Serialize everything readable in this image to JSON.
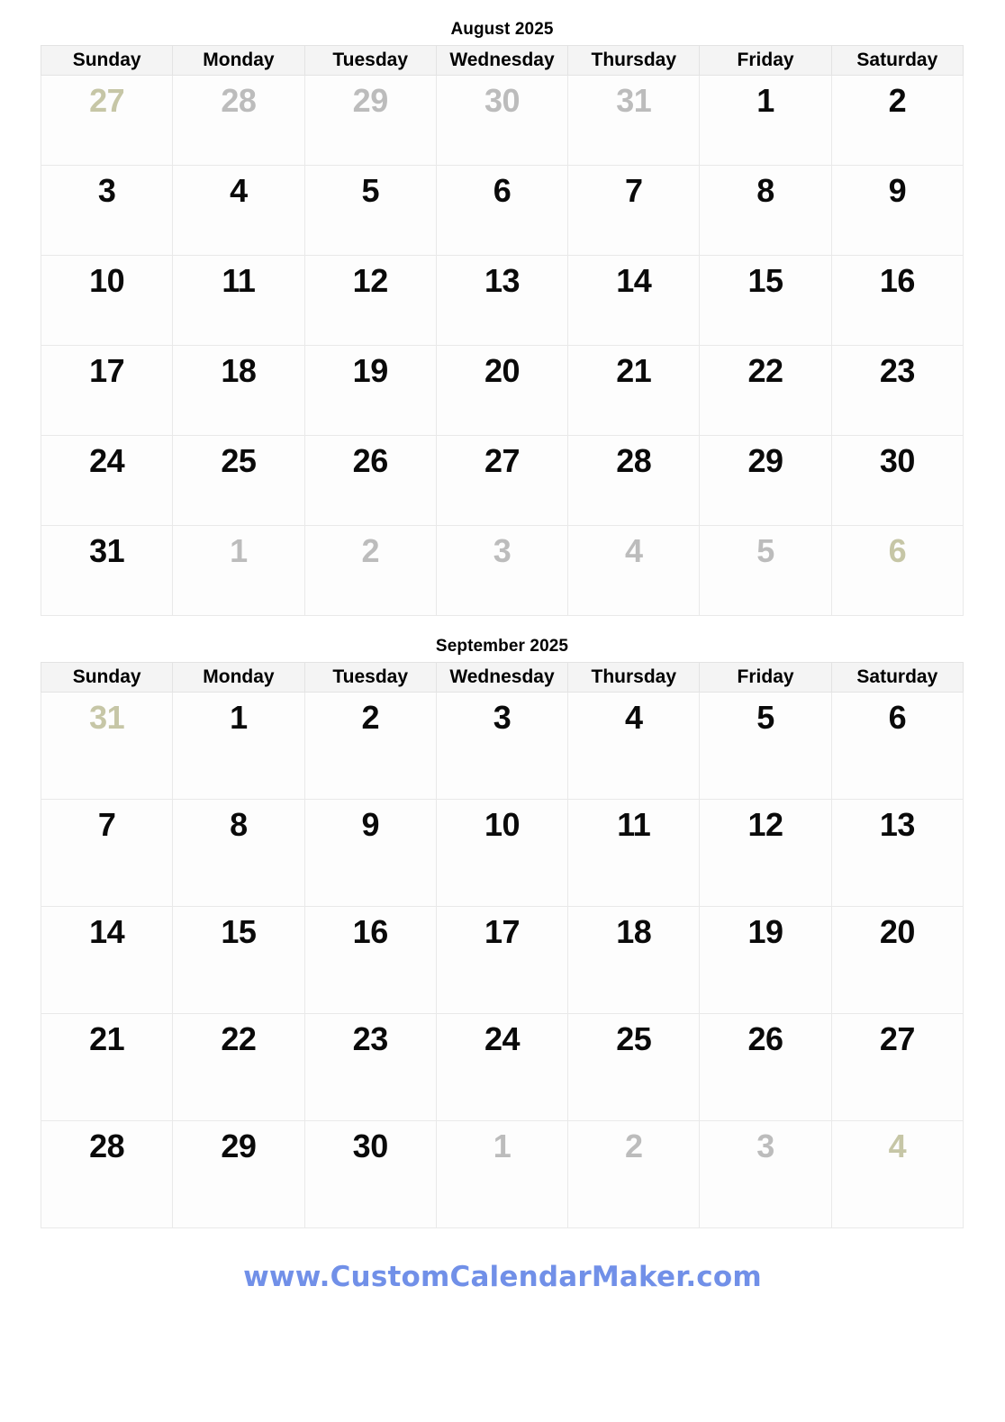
{
  "page": {
    "background_color": "#ffffff",
    "weekend_cell_color": "#fbfbdb",
    "header_row_color": "#f4f4f4",
    "grid_line_color": "#e3e3e3",
    "other_month_text_color": "#bcbcbc",
    "footer_link_color": "#7190e8"
  },
  "weekdays": [
    "Sunday",
    "Monday",
    "Tuesday",
    "Wednesday",
    "Thursday",
    "Friday",
    "Saturday"
  ],
  "calendars": [
    {
      "id": "august",
      "title": "August 2025",
      "weeks": [
        [
          {
            "day": "27",
            "in_month": false
          },
          {
            "day": "28",
            "in_month": false
          },
          {
            "day": "29",
            "in_month": false
          },
          {
            "day": "30",
            "in_month": false
          },
          {
            "day": "31",
            "in_month": false
          },
          {
            "day": "1",
            "in_month": true
          },
          {
            "day": "2",
            "in_month": true
          }
        ],
        [
          {
            "day": "3",
            "in_month": true
          },
          {
            "day": "4",
            "in_month": true
          },
          {
            "day": "5",
            "in_month": true
          },
          {
            "day": "6",
            "in_month": true
          },
          {
            "day": "7",
            "in_month": true
          },
          {
            "day": "8",
            "in_month": true
          },
          {
            "day": "9",
            "in_month": true
          }
        ],
        [
          {
            "day": "10",
            "in_month": true
          },
          {
            "day": "11",
            "in_month": true
          },
          {
            "day": "12",
            "in_month": true
          },
          {
            "day": "13",
            "in_month": true
          },
          {
            "day": "14",
            "in_month": true
          },
          {
            "day": "15",
            "in_month": true
          },
          {
            "day": "16",
            "in_month": true
          }
        ],
        [
          {
            "day": "17",
            "in_month": true
          },
          {
            "day": "18",
            "in_month": true
          },
          {
            "day": "19",
            "in_month": true
          },
          {
            "day": "20",
            "in_month": true
          },
          {
            "day": "21",
            "in_month": true
          },
          {
            "day": "22",
            "in_month": true
          },
          {
            "day": "23",
            "in_month": true
          }
        ],
        [
          {
            "day": "24",
            "in_month": true
          },
          {
            "day": "25",
            "in_month": true
          },
          {
            "day": "26",
            "in_month": true
          },
          {
            "day": "27",
            "in_month": true
          },
          {
            "day": "28",
            "in_month": true
          },
          {
            "day": "29",
            "in_month": true
          },
          {
            "day": "30",
            "in_month": true
          }
        ],
        [
          {
            "day": "31",
            "in_month": true
          },
          {
            "day": "1",
            "in_month": false
          },
          {
            "day": "2",
            "in_month": false
          },
          {
            "day": "3",
            "in_month": false
          },
          {
            "day": "4",
            "in_month": false
          },
          {
            "day": "5",
            "in_month": false
          },
          {
            "day": "6",
            "in_month": false
          }
        ]
      ]
    },
    {
      "id": "september",
      "title": "September 2025",
      "weeks": [
        [
          {
            "day": "31",
            "in_month": false
          },
          {
            "day": "1",
            "in_month": true
          },
          {
            "day": "2",
            "in_month": true
          },
          {
            "day": "3",
            "in_month": true
          },
          {
            "day": "4",
            "in_month": true
          },
          {
            "day": "5",
            "in_month": true
          },
          {
            "day": "6",
            "in_month": true
          }
        ],
        [
          {
            "day": "7",
            "in_month": true
          },
          {
            "day": "8",
            "in_month": true
          },
          {
            "day": "9",
            "in_month": true
          },
          {
            "day": "10",
            "in_month": true
          },
          {
            "day": "11",
            "in_month": true
          },
          {
            "day": "12",
            "in_month": true
          },
          {
            "day": "13",
            "in_month": true
          }
        ],
        [
          {
            "day": "14",
            "in_month": true
          },
          {
            "day": "15",
            "in_month": true
          },
          {
            "day": "16",
            "in_month": true
          },
          {
            "day": "17",
            "in_month": true
          },
          {
            "day": "18",
            "in_month": true
          },
          {
            "day": "19",
            "in_month": true
          },
          {
            "day": "20",
            "in_month": true
          }
        ],
        [
          {
            "day": "21",
            "in_month": true
          },
          {
            "day": "22",
            "in_month": true
          },
          {
            "day": "23",
            "in_month": true
          },
          {
            "day": "24",
            "in_month": true
          },
          {
            "day": "25",
            "in_month": true
          },
          {
            "day": "26",
            "in_month": true
          },
          {
            "day": "27",
            "in_month": true
          }
        ],
        [
          {
            "day": "28",
            "in_month": true
          },
          {
            "day": "29",
            "in_month": true
          },
          {
            "day": "30",
            "in_month": true
          },
          {
            "day": "1",
            "in_month": false
          },
          {
            "day": "2",
            "in_month": false
          },
          {
            "day": "3",
            "in_month": false
          },
          {
            "day": "4",
            "in_month": false
          }
        ]
      ]
    }
  ],
  "footer": {
    "url_text": "www.CustomCalendarMaker.com"
  }
}
